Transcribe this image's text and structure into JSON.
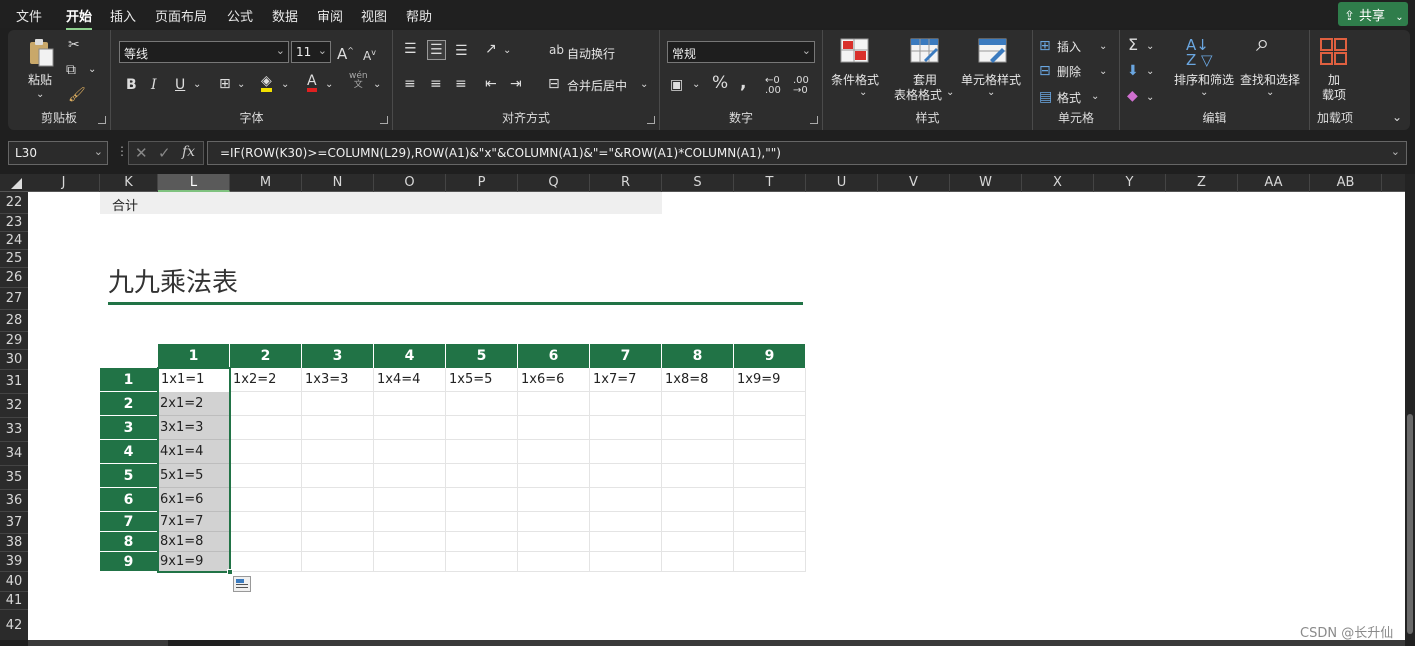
{
  "menu": [
    "文件",
    "开始",
    "插入",
    "页面布局",
    "公式",
    "数据",
    "审阅",
    "视图",
    "帮助"
  ],
  "share_label": "共享",
  "ribbon": {
    "clipboard": {
      "paste": "粘贴",
      "label": "剪贴板"
    },
    "font": {
      "name": "等线",
      "size": "11",
      "label": "字体",
      "wen": "wén\n文"
    },
    "align": {
      "wrap": "自动换行",
      "merge": "合并后居中",
      "label": "对齐方式"
    },
    "number": {
      "format": "常规",
      "label": "数字"
    },
    "styles": {
      "cond": "条件格式",
      "table1": "套用",
      "table2": "表格格式",
      "cell": "单元格样式",
      "label": "样式"
    },
    "cells": {
      "insert": "插入",
      "delete": "删除",
      "format": "格式",
      "label": "单元格"
    },
    "editing": {
      "sort": "排序和筛选",
      "find": "查找和选择",
      "label": "编辑"
    },
    "addins": {
      "l1": "加",
      "l2": "载项",
      "label": "加载项"
    }
  },
  "namebox": "L30",
  "formula": "=IF(ROW(K30)>=COLUMN(L29),ROW(A1)&\"x\"&COLUMN(A1)&\"=\"&ROW(A1)*COLUMN(A1),\"\")",
  "columns": [
    "J",
    "K",
    "L",
    "M",
    "N",
    "O",
    "P",
    "Q",
    "R",
    "S",
    "T",
    "U",
    "V",
    "W",
    "X",
    "Y",
    "Z",
    "AA",
    "AB"
  ],
  "selected_column": "L",
  "rows": [
    "22",
    "23",
    "24",
    "25",
    "26",
    "27",
    "28",
    "29",
    "30",
    "31",
    "32",
    "33",
    "34",
    "35",
    "36",
    "37",
    "38",
    "39",
    "40",
    "41",
    "42"
  ],
  "heji": "合计",
  "title": "九九乘法表",
  "table": {
    "col_headers": [
      "1",
      "2",
      "3",
      "4",
      "5",
      "6",
      "7",
      "8",
      "9"
    ],
    "row_headers": [
      "1",
      "2",
      "3",
      "4",
      "5",
      "6",
      "7",
      "8",
      "9"
    ],
    "first_row": [
      "1x1=1",
      "1x2=2",
      "1x3=3",
      "1x4=4",
      "1x5=5",
      "1x6=6",
      "1x7=7",
      "1x8=8",
      "1x9=9"
    ],
    "first_col": [
      "2x1=2",
      "3x1=3",
      "4x1=4",
      "5x1=5",
      "6x1=6",
      "7x1=7",
      "8x1=8",
      "9x1=9"
    ]
  },
  "watermark": "CSDN @长升仙",
  "colors": {
    "accent": "#217346",
    "selection_fill": "#d2d2d2"
  }
}
